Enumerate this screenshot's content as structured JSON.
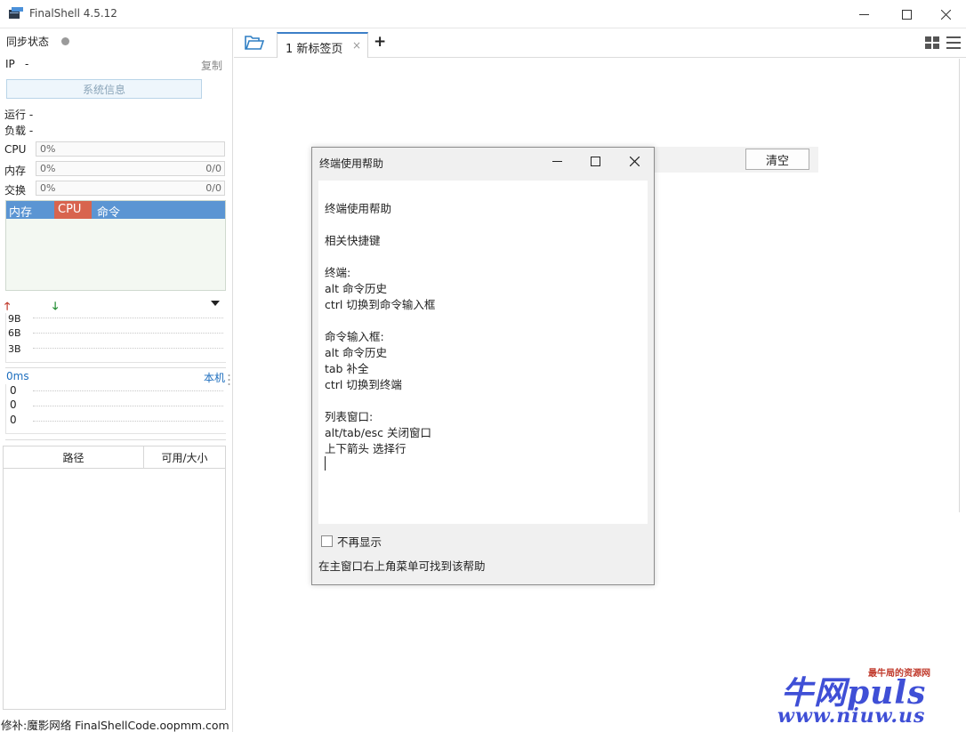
{
  "window": {
    "title": "FinalShell 4.5.12"
  },
  "sidebar": {
    "sync_status": "同步状态",
    "ip_label": "IP",
    "ip_value": "-",
    "copy": "复制",
    "sysinfo_button": "系统信息",
    "run": "运行 -",
    "load": "负载 -",
    "meters": [
      {
        "label": "CPU",
        "percent": "0%",
        "count": ""
      },
      {
        "label": "内存",
        "percent": "0%",
        "count": "0/0"
      },
      {
        "label": "交换",
        "percent": "0%",
        "count": "0/0"
      }
    ],
    "process_tabs": [
      "内存",
      "CPU",
      "命令"
    ],
    "net_ticks": [
      "9B",
      "6B",
      "3B"
    ],
    "ping_label": "0ms",
    "ping_host": "本机",
    "ping_ticks": [
      "0",
      "0",
      "0"
    ],
    "file_table": {
      "columns": [
        "路径",
        "可用/大小"
      ]
    },
    "footer": "修补:魔影网络 FinalShellCode.oopmm.com"
  },
  "tabs": {
    "items": [
      {
        "label": "1 新标签页",
        "close": "×"
      }
    ],
    "add": "+"
  },
  "toolbar": {
    "clear_button": "清空"
  },
  "dialog": {
    "title": "终端使用帮助",
    "lines": [
      "终端使用帮助",
      "",
      "相关快捷键",
      "",
      "终端:",
      "alt 命令历史",
      "ctrl 切换到命令输入框",
      "",
      "命令输入框:",
      "alt 命令历史",
      "tab 补全",
      "ctrl 切换到终端",
      "",
      "列表窗口:",
      "alt/tab/esc 关闭窗口",
      "上下箭头 选择行"
    ],
    "dont_show": "不再显示",
    "footer": "在主窗口右上角菜单可找到该帮助"
  },
  "watermark": {
    "brand": "牛网puls",
    "tagline": "最牛局的资源网",
    "url": "www.niuw.us"
  },
  "colors": {
    "tab_accent": "#3c7fc8",
    "process_header": "#5b95d3",
    "cpu_tab": "#d8644e",
    "ping_text": "#1f6fbf",
    "watermark": "#3f4fd6"
  }
}
